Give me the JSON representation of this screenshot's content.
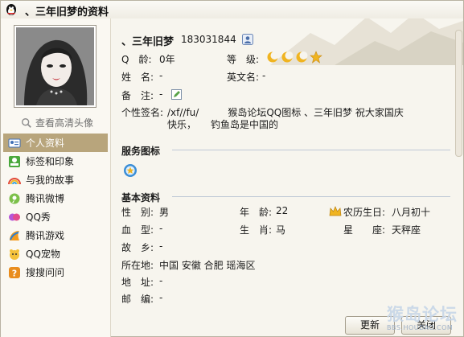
{
  "window": {
    "title": "、三年旧梦的资料"
  },
  "profile": {
    "nickname": "、三年旧梦",
    "qq_number": "183031844",
    "view_hd_avatar": "查看高清头像"
  },
  "info": {
    "age_label": "Q　龄:",
    "age_value": "0年",
    "level_label": "等　级:",
    "name_label": "姓　名:",
    "name_value": "-",
    "en_name_label": "英文名:",
    "en_name_value": "-",
    "remark_label": "备　注:",
    "remark_value": "-",
    "signature_label": "个性签名:",
    "signature_line1": "/xf//fu/　　　猴岛论坛QQ图标 、三年旧梦 祝大家国庆",
    "signature_line2": "快乐，　　钓鱼岛是中国的"
  },
  "sections": {
    "service_icons": "服务图标",
    "basic_info": "基本资料"
  },
  "basic": {
    "gender_label": "性　别:",
    "gender_value": "男",
    "age_label": "年　龄:",
    "age_value": "22",
    "lunar_label": "农历生日:",
    "lunar_value": "八月初十",
    "blood_label": "血　型:",
    "blood_value": "-",
    "zodiac_label": "生　肖:",
    "zodiac_value": "马",
    "constellation_label": "星　　座:",
    "constellation_value": "天秤座",
    "hometown_label": "故　乡:",
    "hometown_value": "-",
    "location_label": "所在地:",
    "location_value": "中国 安徽 合肥 瑶海区",
    "address_label": "地　址:",
    "address_value": "-",
    "zip_label": "邮　编:",
    "zip_value": "-"
  },
  "nav": [
    {
      "label": "个人资料",
      "icon": "profile-card-icon",
      "active": true
    },
    {
      "label": "标签和印象",
      "icon": "tag-icon",
      "active": false
    },
    {
      "label": "与我的故事",
      "icon": "rainbow-icon",
      "active": false
    },
    {
      "label": "腾讯微博",
      "icon": "weibo-icon",
      "active": false
    },
    {
      "label": "QQ秀",
      "icon": "qq-show-icon",
      "active": false
    },
    {
      "label": "腾讯游戏",
      "icon": "game-icon",
      "active": false
    },
    {
      "label": "QQ宠物",
      "icon": "pet-icon",
      "active": false
    },
    {
      "label": "搜搜问问",
      "icon": "question-icon",
      "active": false
    }
  ],
  "buttons": {
    "refresh": "更新",
    "close": "关闭"
  },
  "watermark": {
    "line1": "猴岛论坛",
    "line2": "BBS.HOUDAO.COM"
  },
  "colors": {
    "accent": "#b8a57c",
    "section_line": "#bfc9d6",
    "level_moon": "#e8a515"
  }
}
